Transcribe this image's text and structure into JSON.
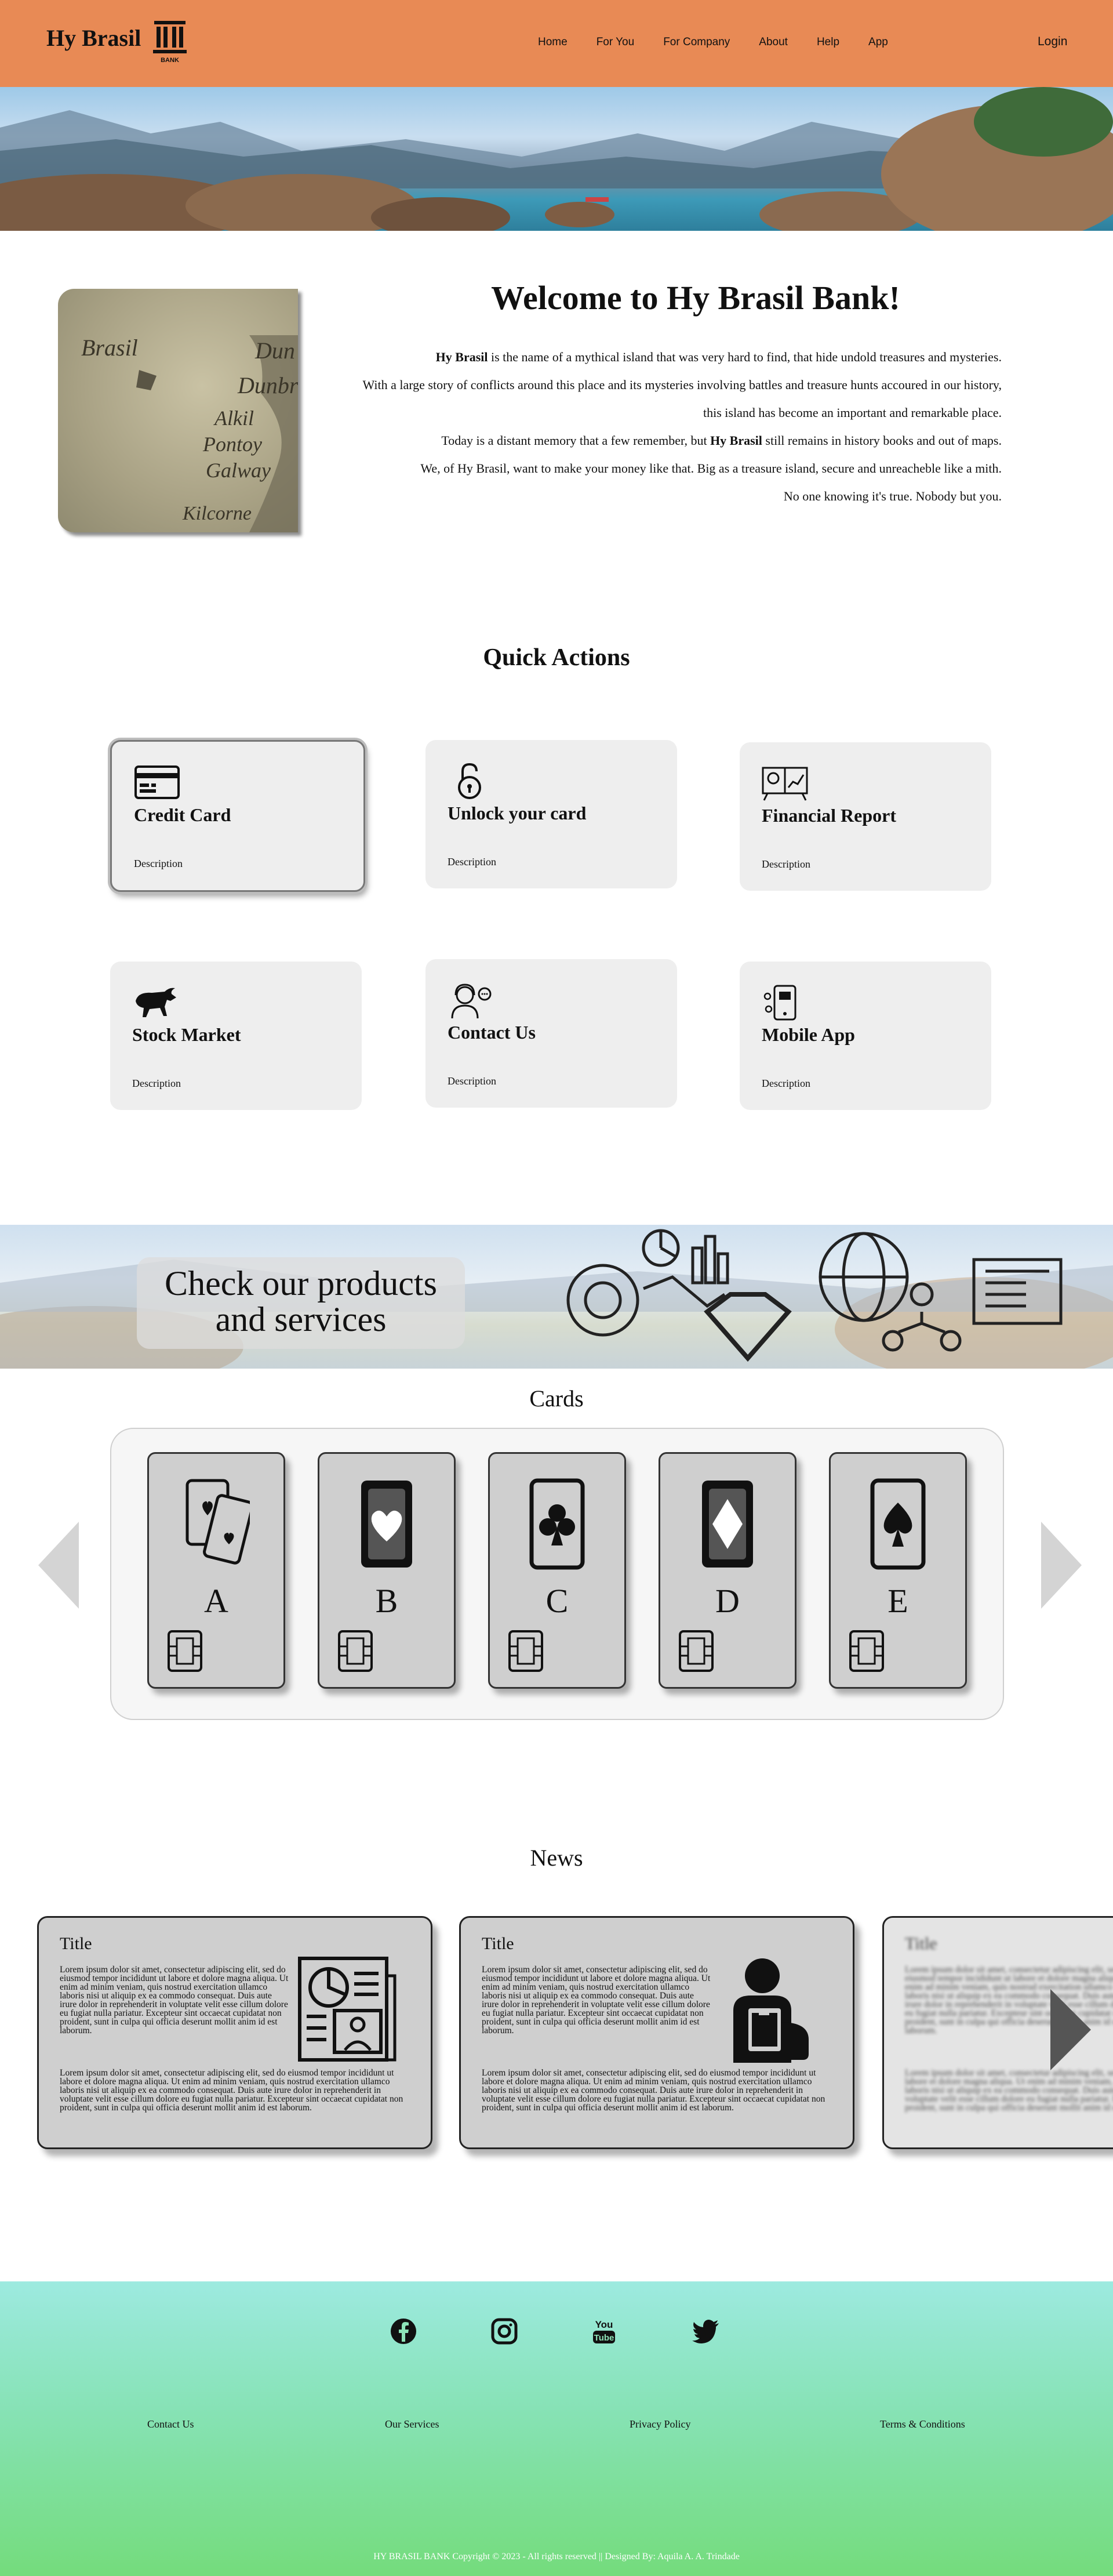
{
  "header": {
    "logo_text": "Hy Brasil",
    "logo_sub": "BANK",
    "nav": [
      "Home",
      "For You",
      "For Company",
      "About",
      "Help",
      "App"
    ],
    "login": "Login"
  },
  "welcome": {
    "title": "Welcome to Hy Brasil Bank!",
    "line1_bold": "Hy Brasil",
    "line1_rest": " is the name of a mythical island that was very hard to find, that hide undold treasures and mysteries.",
    "line2": "With a large story of conflicts around this place and its mysteries involving battles and treasure hunts accoured in our history,",
    "line3": "this island has become an important and remarkable place.",
    "line4_start": "Today is a distant memory that a few remember, but ",
    "line4_bold": "Hy Brasil",
    "line4_end": " still remains in history books and out of maps.",
    "line5": "We, of Hy Brasil, want to make your money like that. Big as a treasure island, secure and unreacheble like a mith.",
    "line6": "No one knowing it's true. Nobody but you.",
    "map_labels": [
      "Brasil",
      "Dun",
      "Dunbr",
      "Alkil",
      "Pontoy",
      "Galway",
      "Kilcorne"
    ]
  },
  "quick_actions": {
    "title": "Quick Actions",
    "items": [
      {
        "title": "Credit Card",
        "desc": "Description",
        "icon": "credit-card-icon"
      },
      {
        "title": "Unlock your card",
        "desc": "Description",
        "icon": "padlock-icon"
      },
      {
        "title": "Financial Report",
        "desc": "Description",
        "icon": "report-icon"
      },
      {
        "title": "Stock Market",
        "desc": "Description",
        "icon": "bull-icon"
      },
      {
        "title": "Contact  Us",
        "desc": "Description",
        "icon": "support-agent-icon"
      },
      {
        "title": "Mobile App",
        "desc": "Description",
        "icon": "mobile-app-icon"
      }
    ]
  },
  "products": {
    "banner_line1": "Check our products",
    "banner_line2": "and services",
    "cards_title": "Cards",
    "cards": [
      {
        "letter": "A",
        "suit": "hearts-cards"
      },
      {
        "letter": "B",
        "suit": "heart"
      },
      {
        "letter": "C",
        "suit": "club"
      },
      {
        "letter": "D",
        "suit": "diamond"
      },
      {
        "letter": "E",
        "suit": "spade"
      }
    ]
  },
  "news": {
    "title": "News",
    "items": [
      {
        "title": "Title",
        "p1": "Lorem ipsum dolor sit amet, consectetur adipiscing elit, sed do eiusmod tempor incididunt ut labore et dolore magna aliqua. Ut enim ad minim veniam, quis nostrud exercitation ullamco laboris nisi ut aliquip ex ea commodo consequat. Duis aute irure dolor in reprehenderit in voluptate velit esse cillum dolore eu fugiat nulla pariatur. Excepteur sint occaecat cupidatat non proident, sunt in culpa qui officia deserunt mollit anim id est laborum.",
        "p2": "Lorem ipsum dolor sit amet, consectetur adipiscing elit, sed do eiusmod tempor incididunt ut labore et dolore magna aliqua. Ut enim ad minim veniam, quis nostrud exercitation ullamco laboris nisi ut aliquip ex ea commodo consequat. Duis aute irure dolor in reprehenderit in voluptate velit esse cillum dolore eu fugiat nulla pariatur. Excepteur sint occaecat cupidatat non proident, sunt in culpa qui officia deserunt mollit anim id est laborum."
      },
      {
        "title": "Title",
        "p1": "Lorem ipsum dolor sit amet, consectetur adipiscing elit, sed do eiusmod tempor incididunt ut labore et dolore magna aliqua. Ut enim ad minim veniam, quis nostrud exercitation ullamco laboris nisi ut aliquip ex ea commodo consequat. Duis aute irure dolor in reprehenderit in voluptate velit esse cillum dolore eu fugiat nulla pariatur. Excepteur sint occaecat cupidatat non proident, sunt in culpa qui officia deserunt mollit anim id est laborum.",
        "p2": "Lorem ipsum dolor sit amet, consectetur adipiscing elit, sed do eiusmod tempor incididunt ut labore et dolore magna aliqua. Ut enim ad minim veniam, quis nostrud exercitation ullamco laboris nisi ut aliquip ex ea commodo consequat. Duis aute irure dolor in reprehenderit in voluptate velit esse cillum dolore eu fugiat nulla pariatur. Excepteur sint occaecat cupidatat non proident, sunt in culpa qui officia deserunt mollit anim id est laborum."
      },
      {
        "title": "Title",
        "p1": "Lorem ipsum dolor sit amet, consectetur adipiscing elit, sed do eiusmod tempor incididunt ut labore et dolore magna aliqua. Ut enim ad minim veniam, quis nostrud exercitation ullamco laboris nisi ut aliquip ex ea commodo consequat. Duis aute irure dolor in reprehenderit in voluptate velit esse cillum dolore eu fugiat nulla pariatur. Excepteur sint occaecat cupidatat non proident, sunt in culpa qui officia deserunt mollit anim id est laborum.",
        "p2": "Lorem ipsum dolor sit amet, consectetur adipiscing elit, sed do eiusmod tempor incididunt ut labore et dolore magna aliqua. Ut enim ad minim veniam, quis nostrud exercitation ullamco laboris nisi ut aliquip ex ea commodo consequat. Duis aute irure dolor in reprehenderit in voluptate velit esse cillum dolore eu fugiat nulla pariatur. Excepteur sint occaecat cupidatat non proident, sunt in culpa qui officia deserunt mollit anim id est laborum."
      }
    ]
  },
  "footer": {
    "social": [
      "facebook-icon",
      "instagram-icon",
      "youtube-icon",
      "twitter-icon"
    ],
    "links": [
      "Contact Us",
      "Our Services",
      "Privacy Policy",
      "Terms & Conditions"
    ],
    "copyright": "HY BRASIL BANK Copyright © 2023 - All rights reserved || Designed By: Aquila A. A. Trindade"
  },
  "colors": {
    "header": "#e88a55",
    "card_bg": "#eeeeee",
    "product_card": "#cfcfcf",
    "footer_top": "#9deae0",
    "footer_bottom": "#74dc7c"
  }
}
